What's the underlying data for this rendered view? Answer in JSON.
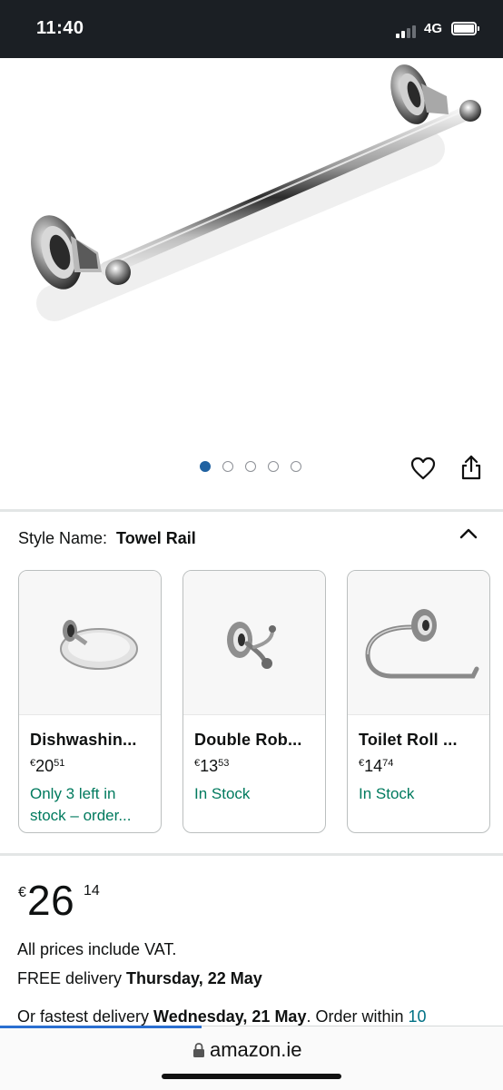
{
  "status_bar": {
    "time": "11:40",
    "network": "4G"
  },
  "product_image": {
    "carousel_count": 5,
    "active_index": 0
  },
  "actions": {
    "wishlist_icon": "heart-icon",
    "share_icon": "share-icon"
  },
  "style": {
    "label": "Style Name:",
    "value": "Towel Rail",
    "toggle_icon": "chevron-up-icon"
  },
  "variants": [
    {
      "title": "Dishwashin...",
      "currency": "€",
      "price_whole": "20",
      "price_fraction": "51",
      "stock_line1": "Only 3 left in",
      "stock_line2": "stock – order..."
    },
    {
      "title": "Double Rob...",
      "currency": "€",
      "price_whole": "13",
      "price_fraction": "53",
      "stock_line1": "In Stock",
      "stock_line2": ""
    },
    {
      "title": "Toilet Roll ...",
      "currency": "€",
      "price_whole": "14",
      "price_fraction": "74",
      "stock_line1": "In Stock",
      "stock_line2": ""
    }
  ],
  "price": {
    "currency": "€",
    "whole": "26",
    "fraction": "14"
  },
  "vat_note": "All prices include VAT.",
  "delivery": {
    "prefix": "FREE delivery ",
    "date": "Thursday, 22 May"
  },
  "fastest_delivery": {
    "prefix": "Or fastest delivery ",
    "date": "Wednesday, 21 May",
    "middle": ". Order within ",
    "countdown": "10"
  },
  "browser": {
    "url": "amazon.ie",
    "load_progress": 0.4
  },
  "colors": {
    "link": "#007185",
    "in_stock": "#007a5e",
    "active_dot": "#2162a1",
    "status_bar": "#1b1f24"
  }
}
